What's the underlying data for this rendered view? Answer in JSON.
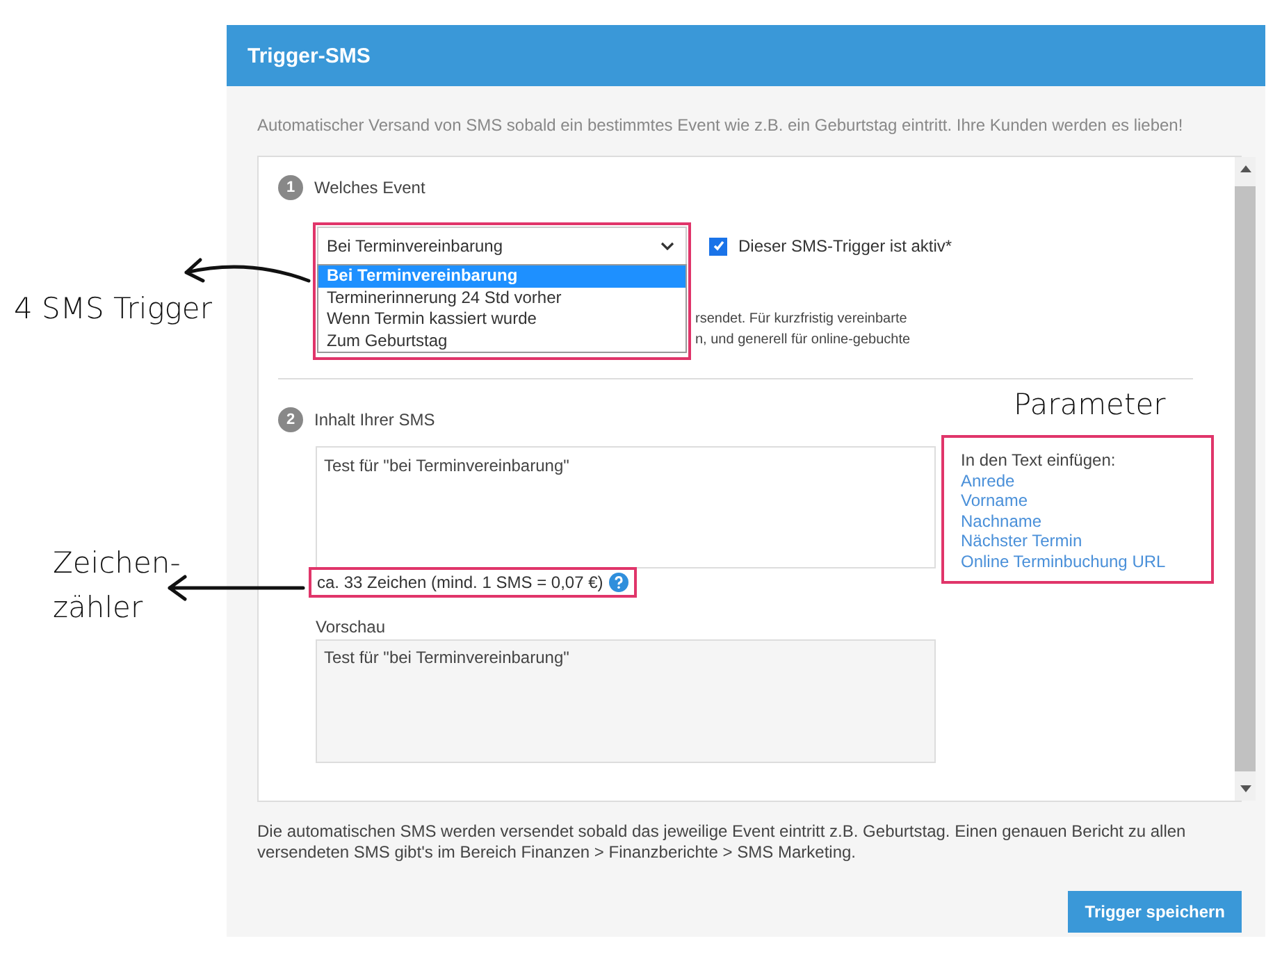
{
  "header": {
    "title": "Trigger-SMS"
  },
  "intro": "Automatischer Versand von SMS sobald ein bestimmtes Event wie z.B. ein Geburtstag eintritt. Ihre Kunden werden es lieben!",
  "step1": {
    "number": "1",
    "label": "Welches Event",
    "select": {
      "value": "Bei Terminvereinbarung",
      "expanded": true,
      "options": [
        {
          "label": "Bei Terminvereinbarung",
          "selected": true
        },
        {
          "label": "Terminerinnerung 24 Std vorher",
          "selected": false
        },
        {
          "label": "Wenn Termin kassiert wurde",
          "selected": false
        },
        {
          "label": "Zum Geburtstag",
          "selected": false
        }
      ]
    },
    "active_checkbox": {
      "label": "Dieser SMS-Trigger ist aktiv*",
      "checked": true
    },
    "hint_lines": [
      "rsendet. Für kurzfristig vereinbarte",
      "n, und generell für online-gebuchte"
    ]
  },
  "step2": {
    "number": "2",
    "label": "Inhalt Ihrer SMS",
    "message": "Test für \"bei Terminvereinbarung\"",
    "counter": "ca. 33 Zeichen (mind. 1 SMS = 0,07 €)",
    "insert": {
      "title": "In den Text einfügen:",
      "links": [
        "Anrede",
        "Vorname",
        "Nachname",
        "Nächster Termin",
        "Online Terminbuchung URL"
      ]
    },
    "preview_label": "Vorschau",
    "preview": "Test für \"bei Terminvereinbarung\""
  },
  "footer_note": "Die automatischen SMS werden versendet sobald das jeweilige Event eintritt z.B. Geburtstag. Einen genauen Bericht zu allen versendeten SMS gibt's im Bereich Finanzen > Finanzberichte > SMS Marketing.",
  "save_button": "Trigger speichern",
  "annotations": {
    "triggers": "4 SMS Trigger",
    "parameters": "Parameter",
    "counter": "Zeichen-zähler"
  }
}
